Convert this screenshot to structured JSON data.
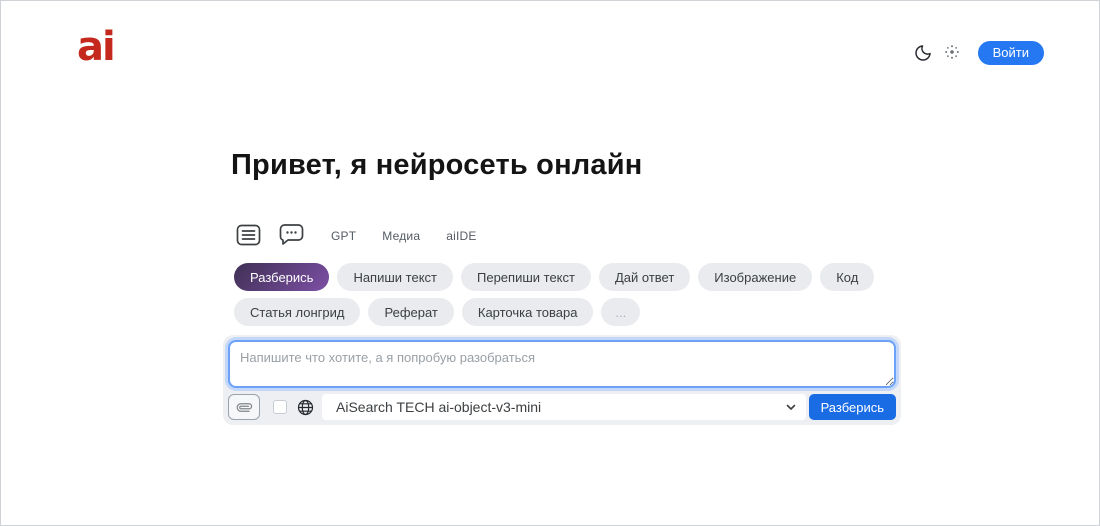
{
  "header": {
    "logo_text": "ai",
    "logo_color": "#c5281c",
    "theme_icons": [
      "moon-icon",
      "sun-icon"
    ],
    "login_button": {
      "label": "Войти",
      "bg": "#2577f2"
    }
  },
  "main": {
    "title": "Привет, я нейросеть онлайн",
    "tabs": {
      "icon_tabs": [
        "list-icon",
        "chat-icon"
      ],
      "text_tabs": [
        {
          "label": "GPT"
        },
        {
          "label": "Медиа"
        },
        {
          "label": "aiIDE"
        }
      ]
    },
    "quick_prompts": {
      "active_color_gradient": [
        "#3f3054",
        "#7d50a5"
      ],
      "row1": [
        {
          "label": "Разберись",
          "active": true
        },
        {
          "label": "Напиши текст",
          "active": false
        },
        {
          "label": "Перепиши текст",
          "active": false
        },
        {
          "label": "Дай ответ",
          "active": false
        },
        {
          "label": "Изображение",
          "active": false
        },
        {
          "label": "Код",
          "active": false
        }
      ],
      "row2": [
        {
          "label": "Статья лонгрид",
          "active": false
        },
        {
          "label": "Реферат",
          "active": false
        },
        {
          "label": "Карточка товара",
          "active": false
        },
        {
          "label": "...",
          "active": false,
          "muted": true
        }
      ]
    },
    "composer": {
      "placeholder": "Напишите что хотите, а я попробую разобраться",
      "attach_icon": "paperclip-icon",
      "web_checkbox_checked": false,
      "globe_icon": "globe-icon",
      "model_select": {
        "value": "AiSearch TECH ai-object-v3-mini"
      },
      "submit_button": {
        "label": "Разберись",
        "bg": "#1a6ce4"
      },
      "focus_border_color": "#6ba1f7"
    }
  }
}
